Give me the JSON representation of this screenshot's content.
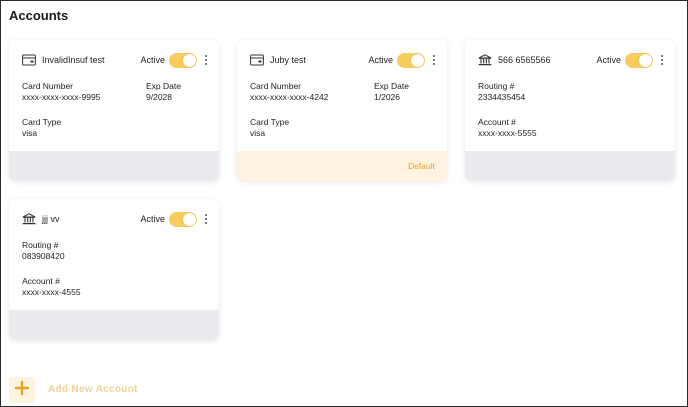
{
  "page": {
    "title": "Accounts"
  },
  "accounts": [
    {
      "kind": "card",
      "name": "InvalidInsuf test",
      "status_label": "Active",
      "field1_label": "Card Number",
      "field1_value": "xxxx-xxxx-xxxx-9995",
      "field2_label": "Exp Date",
      "field2_value": "9/2028",
      "field3_label": "Card Type",
      "field3_value": "visa",
      "footer_label": ""
    },
    {
      "kind": "card",
      "name": "Juby test",
      "status_label": "Active",
      "field1_label": "Card Number",
      "field1_value": "xxxx-xxxx-xxxx-4242",
      "field2_label": "Exp Date",
      "field2_value": "1/2026",
      "field3_label": "Card Type",
      "field3_value": "visa",
      "footer_label": "Default"
    },
    {
      "kind": "bank",
      "name": "566 6565566",
      "status_label": "Active",
      "field1_label": "Routing #",
      "field1_value": "2334435454",
      "field3_label": "Account #",
      "field3_value": "xxxx-xxxx-5555",
      "footer_label": ""
    },
    {
      "kind": "bank",
      "name": "jjj vv",
      "status_label": "Active",
      "field1_label": "Routing #",
      "field1_value": "083908420",
      "field3_label": "Account #",
      "field3_value": "xxxx-xxxx-4555",
      "footer_label": ""
    }
  ],
  "add_account": {
    "label": "Add New Account"
  },
  "colors": {
    "accent": "#f6cd5e",
    "default_bg": "#fdf3e0",
    "default_text": "#e8a31c",
    "footer_bg": "#e9ebef"
  },
  "icons": {
    "card": "credit-card-icon",
    "bank": "bank-icon",
    "menu": "kebab-menu-icon",
    "add": "plus-icon"
  }
}
